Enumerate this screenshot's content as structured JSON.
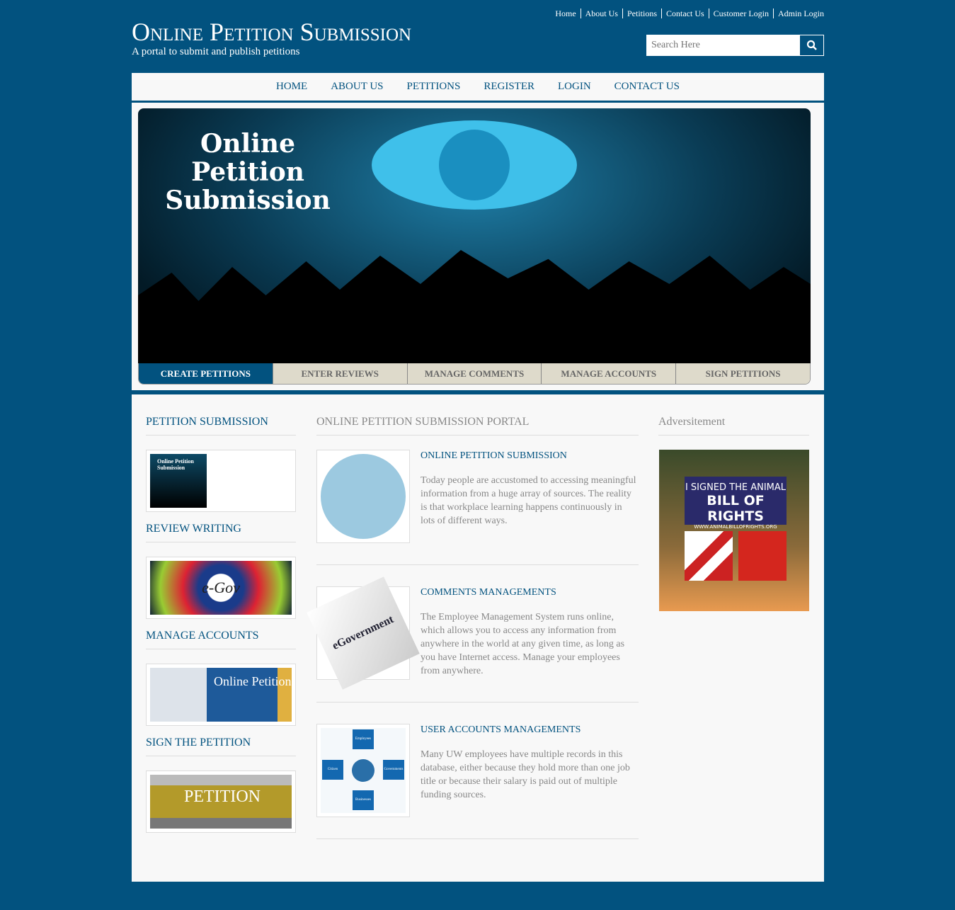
{
  "top_links": [
    "Home",
    "About Us",
    "Petitions",
    "Contact Us",
    "Customer Login",
    "Admin Login"
  ],
  "site": {
    "title": "Online Petition Submission",
    "subtitle": "A portal to submit and publish petitions"
  },
  "search": {
    "placeholder": "Search Here",
    "icon": "search-icon"
  },
  "nav": [
    "HOME",
    "ABOUT US",
    "PETITIONS",
    "REGISTER",
    "LOGIN",
    "CONTACT US"
  ],
  "banner": {
    "lines": [
      "Online",
      "Petition",
      "Submission"
    ]
  },
  "tabs": [
    {
      "label": "CREATE PETITIONS",
      "active": true
    },
    {
      "label": "ENTER REVIEWS"
    },
    {
      "label": "MANAGE COMMENTS"
    },
    {
      "label": "MANAGE ACCOUNTS"
    },
    {
      "label": "SIGN PETITIONS"
    }
  ],
  "sidebar": [
    "PETITION SUBMISSION",
    "REVIEW WRITING",
    "MANAGE ACCOUNTS",
    "SIGN THE PETITION"
  ],
  "sidebar_images": [
    {
      "text": "Online Petition Submission"
    },
    {
      "text": "e-Gov"
    },
    {
      "text": "Online Petition"
    },
    {
      "text": "PETITION"
    }
  ],
  "main": {
    "heading": "ONLINE PETITION SUBMISSION PORTAL",
    "articles": [
      {
        "title": "ONLINE PETITION SUBMISSION",
        "body": "Today people are accustomed to accessing meaningful information from a huge array of sources. The reality is that workplace learning happens continuously in lots of different ways."
      },
      {
        "title": "COMMENTS MANAGEMENTS",
        "body": "The Employee Management System runs online, which allows you to access any information from anywhere in the world at any given time, as long as you have Internet access. Manage your employees from anywhere.",
        "image_text": "eGovernment"
      },
      {
        "title": "USER ACCOUNTS MANAGEMENTS",
        "body": "Many UW employees have multiple records in this database, either because they hold more than one job title or because their salary is paid out of multiple funding sources.",
        "image_labels": [
          "Employees",
          "Citizen",
          "Governments",
          "Businesses"
        ]
      }
    ]
  },
  "ad": {
    "heading": "Adversitement",
    "lines": [
      "I SIGNED THE ANIMAL",
      "BILL OF RIGHTS",
      "WWW.ANIMALBILLOFRIGHTS.ORG"
    ]
  },
  "colors": {
    "primary": "#02527f",
    "tab_bg": "#dedacb",
    "content_bg": "#f8f8f8"
  }
}
